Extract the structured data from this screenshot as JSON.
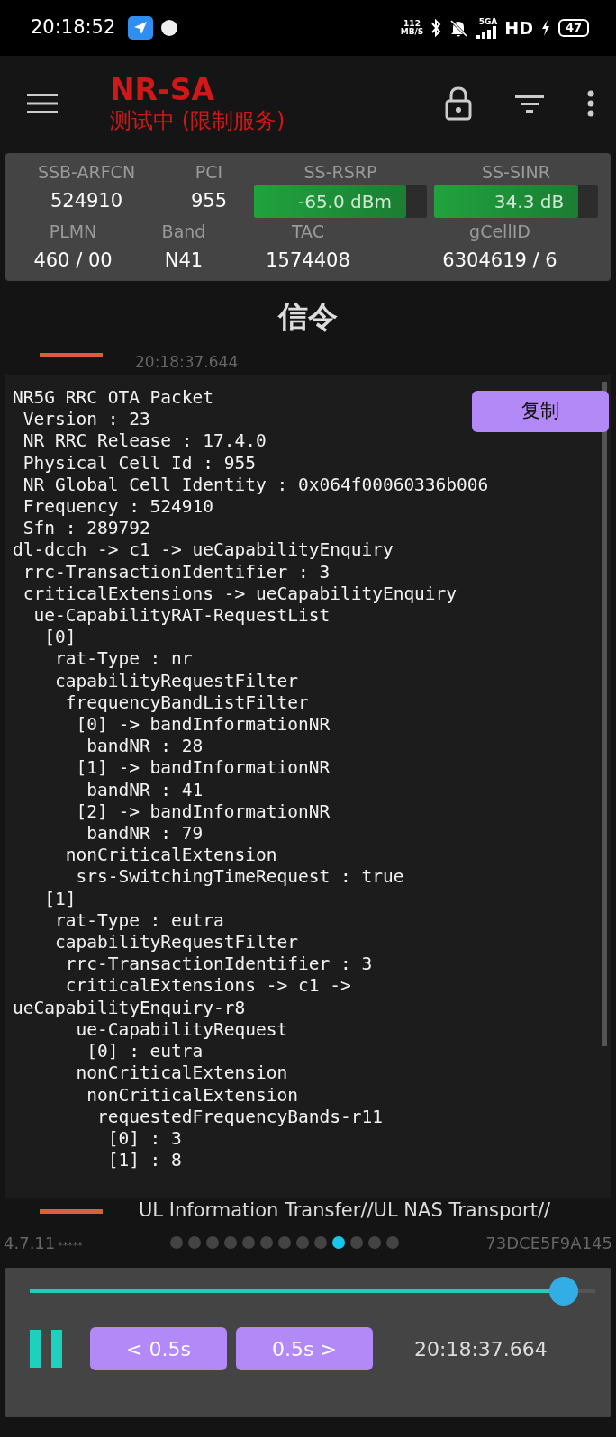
{
  "status_bar": {
    "time": "20:18:52",
    "speed": "112",
    "speed_unit": "MB/S",
    "network": "5GA",
    "hd": "HD",
    "battery": "47"
  },
  "app_bar": {
    "title": "NR-SA",
    "subtitle": "测试中 (限制服务)"
  },
  "info": {
    "rows": [
      [
        {
          "label": "SSB-ARFCN",
          "value": "524910",
          "kind": "text"
        },
        {
          "label": "PCI",
          "value": "955",
          "kind": "text"
        },
        {
          "label": "SS-RSRP",
          "value": "-65.0 dBm",
          "kind": "meter",
          "level": 0.88
        },
        {
          "label": "SS-SINR",
          "value": "34.3 dB",
          "kind": "meter",
          "level": 0.88
        }
      ],
      [
        {
          "label": "PLMN",
          "value": "460 / 00",
          "kind": "text"
        },
        {
          "label": "Band",
          "value": "N41",
          "kind": "text"
        },
        {
          "label": "TAC",
          "value": "1574408",
          "kind": "text"
        },
        {
          "label": "gCellID",
          "value": "6304619 / 6",
          "kind": "text"
        }
      ]
    ]
  },
  "section_title": "信令",
  "list": {
    "top_time": "20:18:37.644",
    "bottom_title": "UL Information Transfer//UL NAS Transport//"
  },
  "packet": {
    "copy_button": "复制",
    "lines": [
      "NR5G RRC OTA Packet",
      " Version : 23",
      " NR RRC Release : 17.4.0",
      " Physical Cell Id : 955",
      " NR Global Cell Identity : 0x064f00060336b006",
      " Frequency : 524910",
      " Sfn : 289792",
      "dl-dcch -> c1 -> ueCapabilityEnquiry",
      " rrc-TransactionIdentifier : 3",
      " criticalExtensions -> ueCapabilityEnquiry",
      "  ue-CapabilityRAT-RequestList",
      "   [0]",
      "    rat-Type : nr",
      "    capabilityRequestFilter",
      "     frequencyBandListFilter",
      "      [0] -> bandInformationNR",
      "       bandNR : 28",
      "      [1] -> bandInformationNR",
      "       bandNR : 41",
      "      [2] -> bandInformationNR",
      "       bandNR : 79",
      "     nonCriticalExtension",
      "      srs-SwitchingTimeRequest : true",
      "   [1]",
      "    rat-Type : eutra",
      "    capabilityRequestFilter",
      "     rrc-TransactionIdentifier : 3",
      "     criticalExtensions -> c1 ->",
      "ueCapabilityEnquiry-r8",
      "      ue-CapabilityRequest",
      "       [0] : eutra",
      "      nonCriticalExtension",
      "       nonCriticalExtension",
      "        requestedFrequencyBands-r11",
      "         [0] : 3",
      "         [1] : 8"
    ]
  },
  "footer": {
    "version": "4.7.11",
    "stars": "*****",
    "pages": [
      {
        "selected": false
      },
      {
        "selected": false
      },
      {
        "selected": false
      },
      {
        "selected": false
      },
      {
        "selected": false
      },
      {
        "selected": false
      },
      {
        "selected": false
      },
      {
        "selected": false
      },
      {
        "selected": false
      },
      {
        "selected": true
      },
      {
        "selected": false
      },
      {
        "selected": false
      },
      {
        "selected": false
      }
    ],
    "device_id": "73DCE5F9A145"
  },
  "player": {
    "level": 0.945,
    "playing": true,
    "back_button": "< 0.5s",
    "forward_button": "0.5s >",
    "time": "20:18:37.664"
  }
}
